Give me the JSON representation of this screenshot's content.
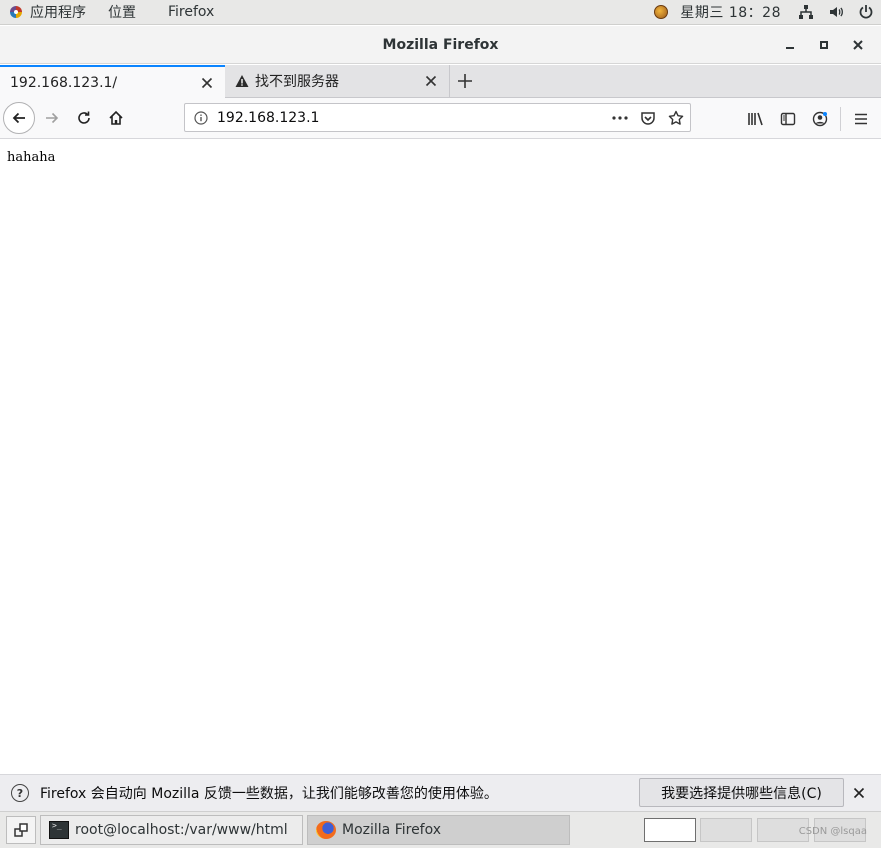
{
  "topbar": {
    "apps_label": "应用程序",
    "places_label": "位置",
    "active_app_label": "Firefox",
    "clock": "星期三 18：28"
  },
  "window": {
    "title": "Mozilla Firefox"
  },
  "tabs": [
    {
      "label": "192.168.123.1/",
      "active": true
    },
    {
      "label": "找不到服务器",
      "active": false
    }
  ],
  "navbar": {
    "url": "192.168.123.1"
  },
  "page": {
    "text": "hahaha"
  },
  "notification": {
    "text": "Firefox 会自动向 Mozilla 反馈一些数据，让我们能够改善您的使用体验。",
    "button_label": "我要选择提供哪些信息(C)"
  },
  "taskbar": {
    "tasks": [
      {
        "label": "root@localhost:/var/www/html",
        "icon": "terminal-icon",
        "active": false
      },
      {
        "label": "Mozilla Firefox",
        "icon": "firefox-icon",
        "active": true
      }
    ],
    "watermark": "CSDN @lsqaa"
  },
  "colors": {
    "accent": "#0a84ff"
  }
}
